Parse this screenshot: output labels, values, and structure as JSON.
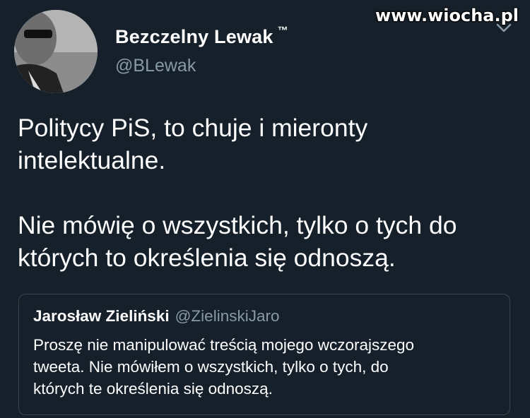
{
  "watermark": "www.wiocha.pl",
  "tweet": {
    "author_name": "Bezczelny Lewak",
    "author_badge": "™",
    "author_handle": "@BLewak",
    "avatar_icon": "user-avatar-photo",
    "menu_icon": "chevron-down-icon",
    "text_paragraphs": [
      [
        "Politycy PiS, to chuje i mieronty",
        "intelektualne."
      ],
      [
        "Nie mówię o wszystkich, tylko o tych do",
        "których to określenia się odnoszą."
      ]
    ]
  },
  "quoted_tweet": {
    "author_name": "Jarosław Zieliński",
    "author_handle": "@ZielinskiJaro",
    "text_lines": [
      "Proszę nie manipulować treścią mojego wczorajszego",
      "tweeta. Nie mówiłem o wszystkich, tylko o tych, do",
      "których te określenia się odnoszą."
    ]
  },
  "colors": {
    "background": "#15202b",
    "primary_text": "#ffffff",
    "secondary_text": "#8899a6",
    "card_border": "#38444d"
  }
}
